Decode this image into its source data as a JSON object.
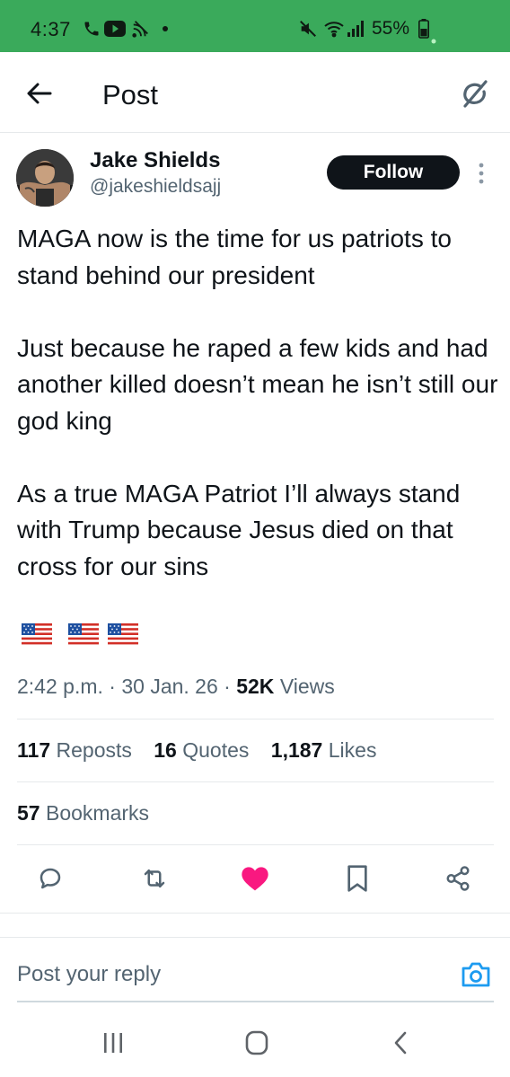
{
  "status_bar": {
    "time": "4:37",
    "battery": "55%",
    "icons": [
      "phone-icon",
      "youtube-icon",
      "cast-icon",
      "dot-icon",
      "mute-icon",
      "wifi-icon",
      "signal-icon",
      "battery-icon"
    ],
    "background_color": "#3aaa5b"
  },
  "header": {
    "title": "Post",
    "back_icon": "arrow-left-icon",
    "grok_icon": "grok-icon"
  },
  "author": {
    "name": "Jake Shields",
    "handle": "@jakeshieldsajj",
    "follow_label": "Follow"
  },
  "tweet": {
    "text": "MAGA now is the time for us patriots to stand behind our president\n\nJust because he raped a few kids and had another killed doesn’t mean he isn’t still our god king\n\nAs a true MAGA Patriot I’ll always stand with Trump because Jesus died on that cross for our sins",
    "flags": [
      "us-flag-icon",
      "us-flag-icon",
      "us-flag-icon"
    ]
  },
  "meta": {
    "time": "2:42 p.m.",
    "date": "30 Jan. 26",
    "views_count": "52K",
    "views_label": "Views",
    "separator": "·"
  },
  "stats": {
    "reposts_count": "117",
    "reposts_label": "Reposts",
    "quotes_count": "16",
    "quotes_label": "Quotes",
    "likes_count": "1,187",
    "likes_label": "Likes",
    "bookmarks_count": "57",
    "bookmarks_label": "Bookmarks"
  },
  "actions": [
    "reply-icon",
    "repost-icon",
    "like-icon",
    "bookmark-icon",
    "share-icon"
  ],
  "colors": {
    "like": "#f91880",
    "text_primary": "#0f1419",
    "text_secondary": "#536471",
    "link_blue": "#1d9bf0"
  },
  "reply": {
    "placeholder": "Post your reply",
    "camera_icon": "camera-icon"
  },
  "nav": [
    "recents-icon",
    "home-icon",
    "back-icon"
  ]
}
